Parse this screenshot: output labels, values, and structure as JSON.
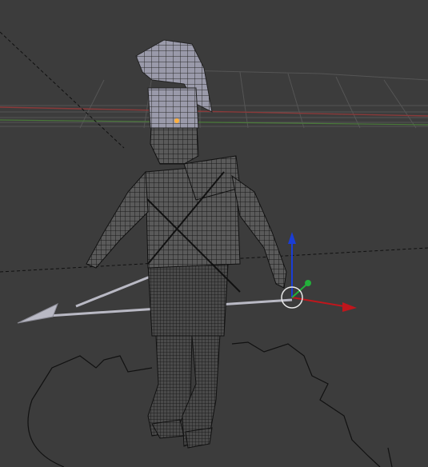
{
  "viewport": {
    "background_color": "#3c3c3c",
    "grid_color": "#555555",
    "axis_x_color": "#9b3a3a",
    "axis_y_color": "#4f8a3a",
    "wire_color": "#1a1a1a",
    "mesh_fill": "#5a5a5a",
    "helmet_fill": "#9a9aaa",
    "spear_color": "#b9b9c4"
  },
  "gizmo": {
    "x_axis_color": "#c0161c",
    "y_axis_color": "#22b13a",
    "z_axis_color": "#1a3dd6",
    "pivot_ring_color": "#e8e8e8",
    "icon_name": "transform-manipulator-icon"
  },
  "object_origin": {
    "icon_name": "object-origin-icon",
    "color": "#ffb040"
  }
}
